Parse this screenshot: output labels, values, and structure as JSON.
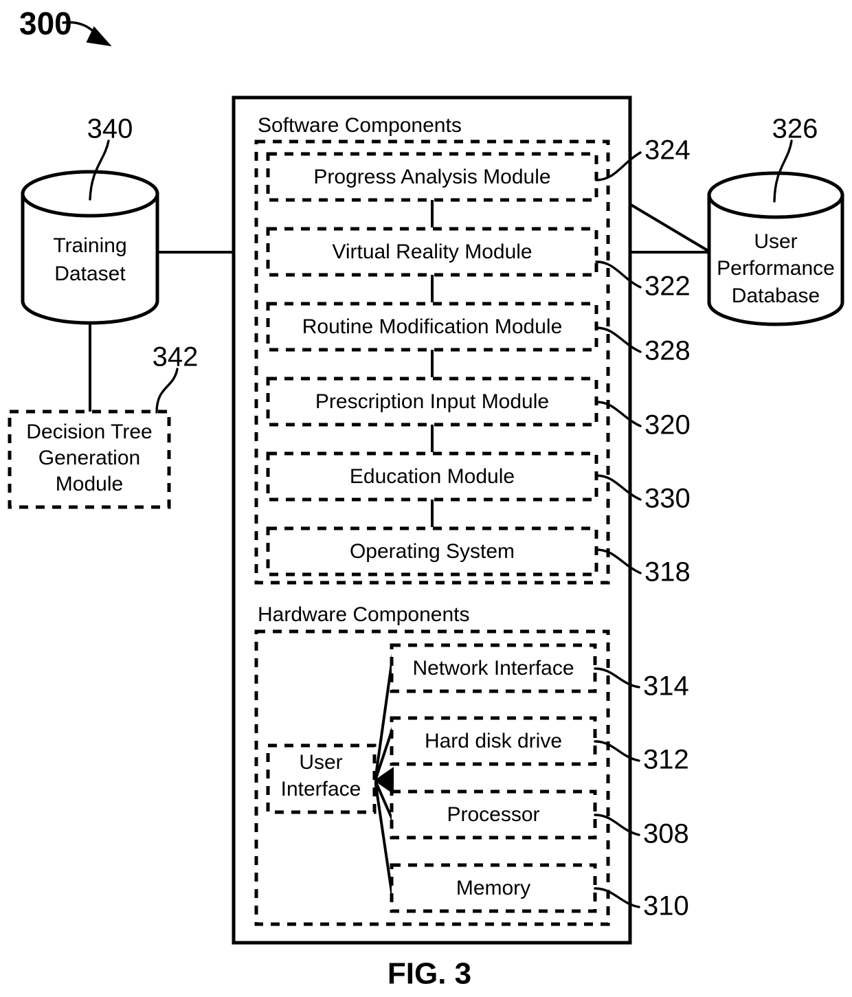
{
  "figure": {
    "title_number": "300",
    "caption": "FIG. 3"
  },
  "left_column": {
    "training_dataset": {
      "label_line1": "Training",
      "label_line2": "Dataset",
      "ref": "340"
    },
    "decision_tree_module": {
      "label_line1": "Decision Tree",
      "label_line2": "Generation",
      "label_line3": "Module",
      "ref": "342"
    }
  },
  "right_column": {
    "user_performance_database": {
      "label_line1": "User",
      "label_line2": "Performance",
      "label_line3": "Database",
      "ref": "326"
    }
  },
  "system": {
    "software_section": {
      "heading": "Software Components",
      "modules": [
        {
          "label": "Progress Analysis Module",
          "ref": "324"
        },
        {
          "label": "Virtual Reality Module",
          "ref": "322"
        },
        {
          "label": "Routine Modification Module",
          "ref": "328"
        },
        {
          "label": "Prescription Input Module",
          "ref": "320"
        },
        {
          "label": "Education Module",
          "ref": "330"
        },
        {
          "label": "Operating System",
          "ref": "318"
        }
      ]
    },
    "hardware_section": {
      "heading": "Hardware Components",
      "user_interface": {
        "label_line1": "User",
        "label_line2": "Interface"
      },
      "components": [
        {
          "label": "Network Interface",
          "ref": "314"
        },
        {
          "label": "Hard disk drive",
          "ref": "312"
        },
        {
          "label": "Processor",
          "ref": "308"
        },
        {
          "label": "Memory",
          "ref": "310"
        }
      ]
    }
  },
  "colors": {
    "stroke": "#000000",
    "background": "#ffffff"
  }
}
